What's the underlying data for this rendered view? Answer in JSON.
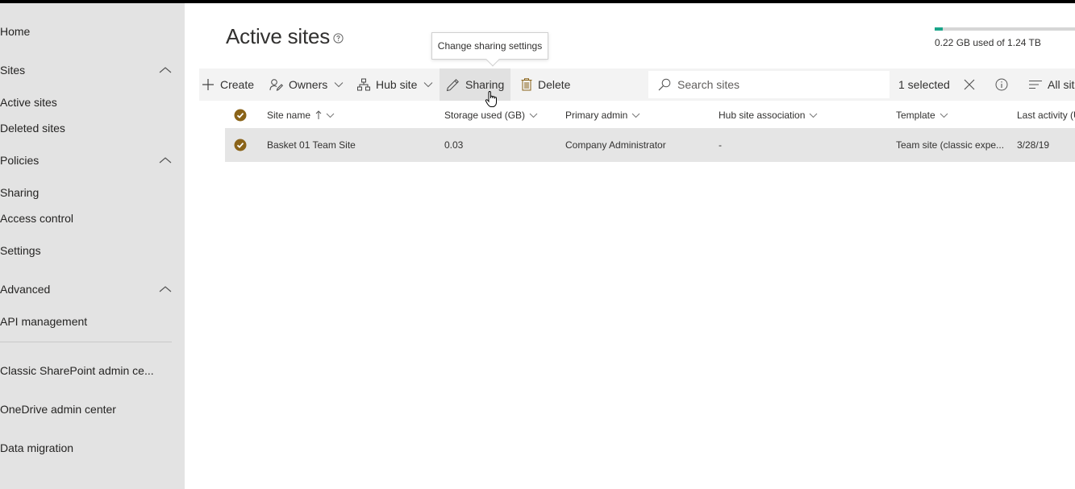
{
  "sidebar": {
    "items": [
      {
        "label": "Home"
      },
      {
        "label": "Sites",
        "expanded": true
      },
      {
        "label": "Active sites"
      },
      {
        "label": "Deleted sites"
      },
      {
        "label": "Policies",
        "expanded": true
      },
      {
        "label": "Sharing"
      },
      {
        "label": "Access control"
      },
      {
        "label": "Settings"
      },
      {
        "label": "Advanced",
        "expanded": true
      },
      {
        "label": "API management"
      },
      {
        "label": "Classic SharePoint admin ce..."
      },
      {
        "label": "OneDrive admin center"
      },
      {
        "label": "Data migration"
      }
    ]
  },
  "page": {
    "title": "Active sites",
    "help_icon": "question-circle-icon"
  },
  "storage": {
    "text": "0.22 GB used of 1.24 TB",
    "used_fraction": 0.035,
    "bar_color": "#1aa58a"
  },
  "tooltip": {
    "text": "Change sharing settings"
  },
  "toolbar": {
    "create": "Create",
    "owners": "Owners",
    "hub_site": "Hub site",
    "sharing": "Sharing",
    "delete": "Delete",
    "search_placeholder": "Search sites",
    "selected_count": "1 selected",
    "view_label": "All sites"
  },
  "table": {
    "columns": [
      {
        "label": "Site name",
        "sort": "ascending"
      },
      {
        "label": "Storage used (GB)"
      },
      {
        "label": "Primary admin"
      },
      {
        "label": "Hub site association"
      },
      {
        "label": "Template"
      },
      {
        "label": "Last activity (UTC)"
      }
    ],
    "rows": [
      {
        "selected": true,
        "site_name": "Basket 01 Team Site",
        "storage_used": "0.03",
        "primary_admin": "Company Administrator",
        "hub_site_association": "-",
        "template": "Team site (classic expe...",
        "last_activity": "3/28/19"
      }
    ]
  },
  "colors": {
    "accent_check": "#8a6318",
    "sidebar_bg": "#e3e3e3",
    "row_selected_bg": "#e5e5e5"
  }
}
